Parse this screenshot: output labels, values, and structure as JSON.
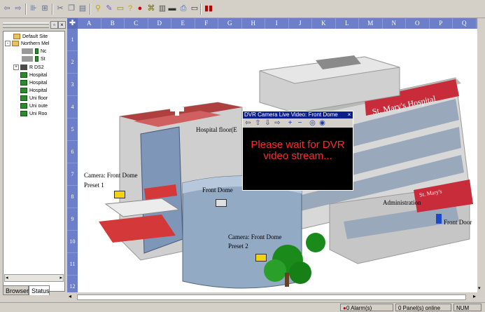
{
  "toolbar": {
    "icons": [
      "back-arrow-icon",
      "forward-arrow-icon",
      "split-view-icon",
      "grid-icon",
      "cut-icon",
      "copy-icon",
      "paste-icon",
      "link-icon",
      "pen-icon",
      "camera-icon",
      "help-icon",
      "alarm-icon",
      "sensor-icon",
      "door-icon",
      "video-icon",
      "print-icon",
      "monitor-icon",
      "exit-icon"
    ]
  },
  "tree": {
    "items": [
      {
        "label": "Default Site",
        "depth": 0,
        "icon": "folder-icon",
        "expander": ""
      },
      {
        "label": "Northern Mel",
        "depth": 0,
        "icon": "folder-icon",
        "expander": "-"
      },
      {
        "label": "Nc",
        "depth": 2,
        "icon": "device-icon",
        "expander": ""
      },
      {
        "label": "St",
        "depth": 2,
        "icon": "device-icon",
        "expander": ""
      },
      {
        "label": "R DS2",
        "depth": 0,
        "icon": "server-icon",
        "expander": "+"
      },
      {
        "label": "Hospital",
        "depth": 1,
        "icon": "map-icon",
        "expander": ""
      },
      {
        "label": "Hospital",
        "depth": 1,
        "icon": "map-icon",
        "expander": ""
      },
      {
        "label": "Hospital",
        "depth": 1,
        "icon": "map-icon",
        "expander": ""
      },
      {
        "label": "Uni floor",
        "depth": 1,
        "icon": "map-icon",
        "expander": ""
      },
      {
        "label": "Uni oute",
        "depth": 1,
        "icon": "map-icon",
        "expander": ""
      },
      {
        "label": "Uni Roo",
        "depth": 1,
        "icon": "map-icon",
        "expander": ""
      }
    ]
  },
  "tabs": {
    "browser": "Browser",
    "status": "Status"
  },
  "grid": {
    "corner": "✚",
    "columns": [
      "A",
      "B",
      "C",
      "D",
      "E",
      "F",
      "G",
      "H",
      "I",
      "J",
      "K",
      "L",
      "M",
      "N",
      "O",
      "P",
      "Q"
    ],
    "rows": [
      "1",
      "2",
      "3",
      "4",
      "5",
      "6",
      "7",
      "8",
      "9",
      "10",
      "11",
      "12"
    ]
  },
  "map": {
    "labels": {
      "hospital_floor": "Hospital floor(E",
      "camera_front_dome_1": "Camera: Front Dome",
      "preset_1": "Preset 1",
      "front_dome": "Front Dome",
      "administration": "Administration",
      "front_door": "Front Door",
      "camera_front_dome_2": "Camera: Front Dome",
      "preset_2": "Preset 2",
      "hospital_sign": "St. Mary's Hospital",
      "sign2": "St. Mary's"
    }
  },
  "dvr": {
    "title": "DVR Camera Live Video: Front Dome",
    "message": "Please wait for DVR video stream...",
    "controls": [
      "left-arrow-icon",
      "up-arrow-icon",
      "down-arrow-icon",
      "right-arrow-icon",
      "plus-icon",
      "minus-icon",
      "zoom-out-icon",
      "zoom-in-icon"
    ]
  },
  "status": {
    "alarms": "0 Alarm(s)",
    "panels": "0 Panel(s) online",
    "num": "NUM"
  },
  "colors": {
    "grid_header": "#6c7fc8",
    "dvr_title": "#0b1f8c",
    "dvr_text": "#ff2a2a"
  }
}
